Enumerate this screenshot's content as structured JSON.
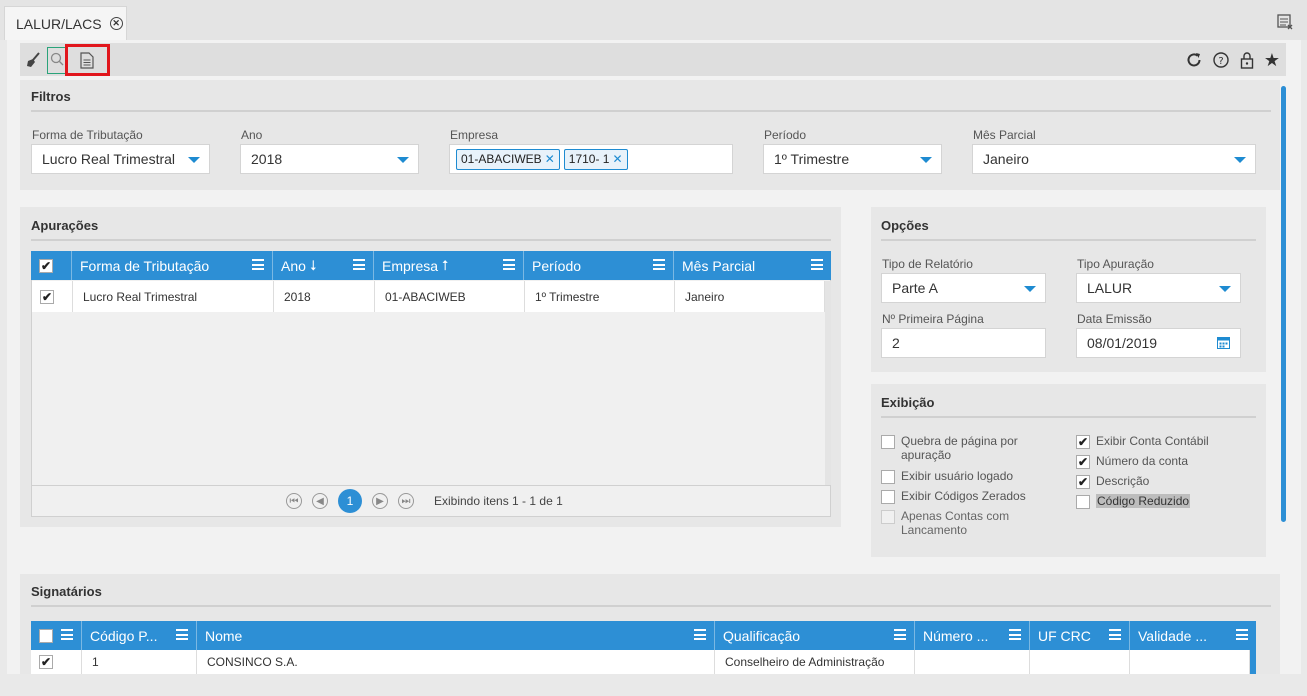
{
  "tab": {
    "title": "LALUR/LACS"
  },
  "filtros": {
    "title": "Filtros",
    "forma_label": "Forma de Tributação",
    "forma_value": "Lucro Real Trimestral",
    "ano_label": "Ano",
    "ano_value": "2018",
    "empresa_label": "Empresa",
    "empresa_chips": [
      "01-ABACIWEB",
      "1710- 1"
    ],
    "periodo_label": "Período",
    "periodo_value": "1º Trimestre",
    "mes_label": "Mês Parcial",
    "mes_value": "Janeiro"
  },
  "apuracoes": {
    "title": "Apurações",
    "columns": [
      "Forma de Tributação",
      "Ano",
      "Empresa",
      "Período",
      "Mês Parcial"
    ],
    "rows": [
      {
        "forma": "Lucro Real Trimestral",
        "ano": "2018",
        "empresa": "01-ABACIWEB",
        "periodo": "1º Trimestre",
        "mes": "Janeiro"
      }
    ],
    "pager": {
      "current": "1",
      "summary": "Exibindo itens 1 - 1 de 1"
    }
  },
  "opcoes": {
    "title": "Opções",
    "tipo_relatorio_label": "Tipo de Relatório",
    "tipo_relatorio_value": "Parte A",
    "tipo_apuracao_label": "Tipo Apuração",
    "tipo_apuracao_value": "LALUR",
    "primeira_pagina_label": "Nº Primeira Página",
    "primeira_pagina_value": "2",
    "data_emissao_label": "Data Emissão",
    "data_emissao_value": "08/01/2019"
  },
  "exibicao": {
    "title": "Exibição",
    "left": [
      {
        "label": "Quebra de página por apuração",
        "checked": false
      },
      {
        "label": "Exibir usuário logado",
        "checked": false
      },
      {
        "label": "Exibir Códigos Zerados",
        "checked": false
      },
      {
        "label": "Apenas Contas com Lancamento",
        "checked": false
      }
    ],
    "right": [
      {
        "label": "Exibir Conta Contábil",
        "checked": true
      },
      {
        "label": "Número da conta",
        "checked": true
      },
      {
        "label": "Descrição",
        "checked": true
      },
      {
        "label": "Código Reduzido",
        "checked": false
      }
    ]
  },
  "signatarios": {
    "title": "Signatários",
    "columns": [
      "Código P...",
      "Nome",
      "Qualificação",
      "Número ...",
      "UF CRC",
      "Validade ..."
    ],
    "rows": [
      {
        "codigo": "1",
        "nome": "CONSINCO S.A.",
        "qualificacao": "Conselheiro de Administração",
        "numero": "",
        "uf": "",
        "validade": ""
      }
    ]
  },
  "colors": {
    "accent": "#2d8fd5",
    "highlight": "#e1161c"
  },
  "icons": [
    "broom-icon",
    "search-icon",
    "document-icon",
    "refresh-icon",
    "help-icon",
    "lock-icon",
    "star-icon",
    "calendar-icon",
    "close-circle-icon",
    "window-list-icon"
  ]
}
